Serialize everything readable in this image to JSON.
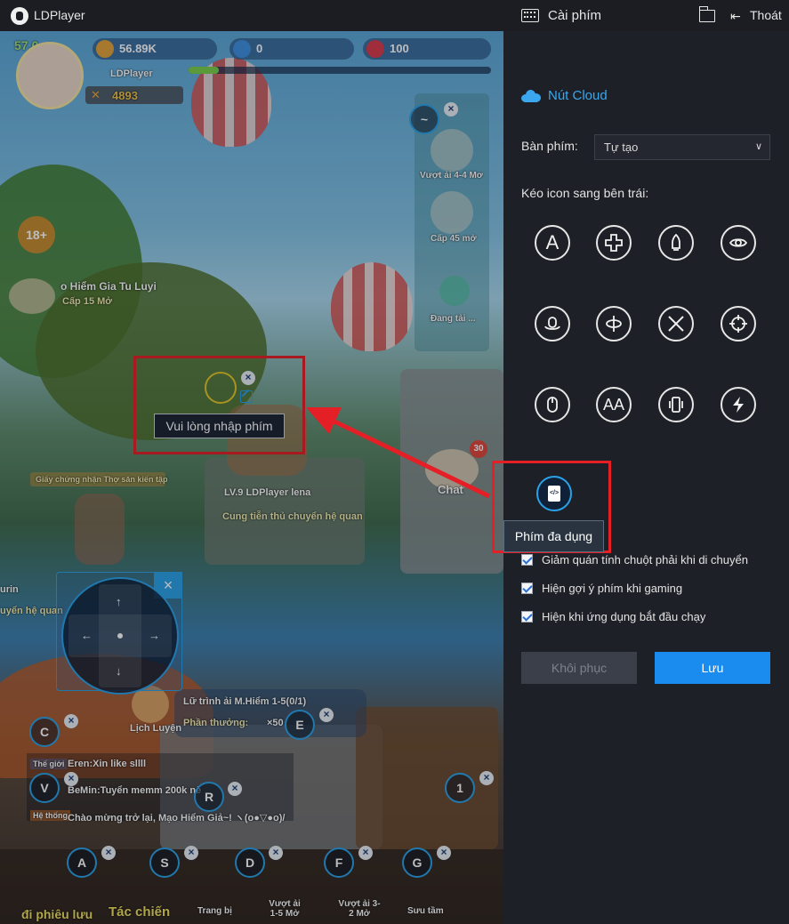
{
  "titlebar": {
    "app_title": "LDPlayer",
    "panel_title": "Cài phím",
    "exit_label": "Thoát"
  },
  "game": {
    "fps": "57.0",
    "coins": "56.89K",
    "gems": "0",
    "rubies": "100",
    "player_name": "LDPlayer",
    "power": "4893",
    "age_rating": "18+",
    "quest1": "Vượt ải 4-4 Mơ",
    "quest2": "Cấp 45 mở",
    "loading": "Đang tải ...",
    "location_title": "o Hiểm Gia Tu Luyi",
    "location_sub": "Cấp 15 Mở",
    "char_name": "LV.9 LDPlayer lena",
    "char_title": "Cung tiễn thủ chuyển hệ quan",
    "cert": "Giấy chứng nhận Thợ săn kiến tập",
    "left_name1": "urin",
    "left_name2": "uyển hệ quan",
    "journey": "Lữ trình ải M.Hiểm 1-5(0/1)",
    "reward_label": "Phần thưởng:",
    "reward_value": "×50",
    "npc_label": "Lịch Luyện",
    "chat_count": "30",
    "chat_label": "Chat",
    "chat1_tag": "Thế giới",
    "chat1": "Eren:Xin like sllll",
    "chat2": "BeMin:Tuyển memm 200k  nè",
    "chat3_tag": "Hệ thống",
    "chat3": "Chào mừng trở lại, Mạo Hiểm Giả~! ヽ(o●▽●o)/",
    "bottom": [
      "đi phiêu lưu",
      "Tác chiến",
      "Trang bị",
      "Vượt ải 1-5 Mở",
      "Vượt ải 3-2 Mở",
      "Sưu tầm"
    ]
  },
  "keys": {
    "tilde": "~",
    "c": "C",
    "v": "V",
    "r": "R",
    "e": "E",
    "one": "1",
    "a": "A",
    "s": "S",
    "d": "D",
    "f": "F",
    "g": "G",
    "close": "×"
  },
  "dpad": {
    "up": "↑",
    "down": "↓",
    "left": "←",
    "right": "→",
    "close": "×"
  },
  "edit": {
    "placeholder": "Vui lòng nhập phím"
  },
  "panel": {
    "cloud_label": "Nút Cloud",
    "keyboard_label": "Bàn phím:",
    "keyboard_value": "Tự tạo",
    "drag_label": "Kéo icon sang bên trái:",
    "icon_a": "A",
    "icon_aa": "AA",
    "multi_tooltip": "Phím đa dụng",
    "check1": "Giảm quán tính chuột phải khi di chuyển",
    "check2": "Hiện gợi ý phím khi gaming",
    "check3": "Hiện khi ứng dụng bắt đầu chạy",
    "reset": "Khôi phục",
    "save": "Lưu"
  },
  "colors": {
    "accent": "#1a8cf0",
    "highlight_red": "#e41f25",
    "key_border": "#2aa1e8"
  }
}
